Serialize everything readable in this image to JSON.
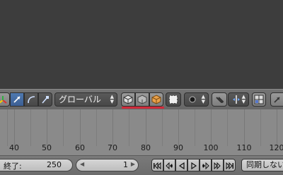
{
  "header": {
    "orientation_dropdown": {
      "value": "グローバル"
    }
  },
  "timeline": {
    "ticks": [
      "40",
      "50",
      "60",
      "70",
      "80",
      "90",
      "100",
      "110",
      "120"
    ]
  },
  "bottom": {
    "end_label": "終了:",
    "end_value": "250",
    "current_frame": "1",
    "sync_label": "同期しない"
  },
  "colors": {
    "accent_underline": "#d12a3a",
    "active_button": "#4f79b0"
  }
}
